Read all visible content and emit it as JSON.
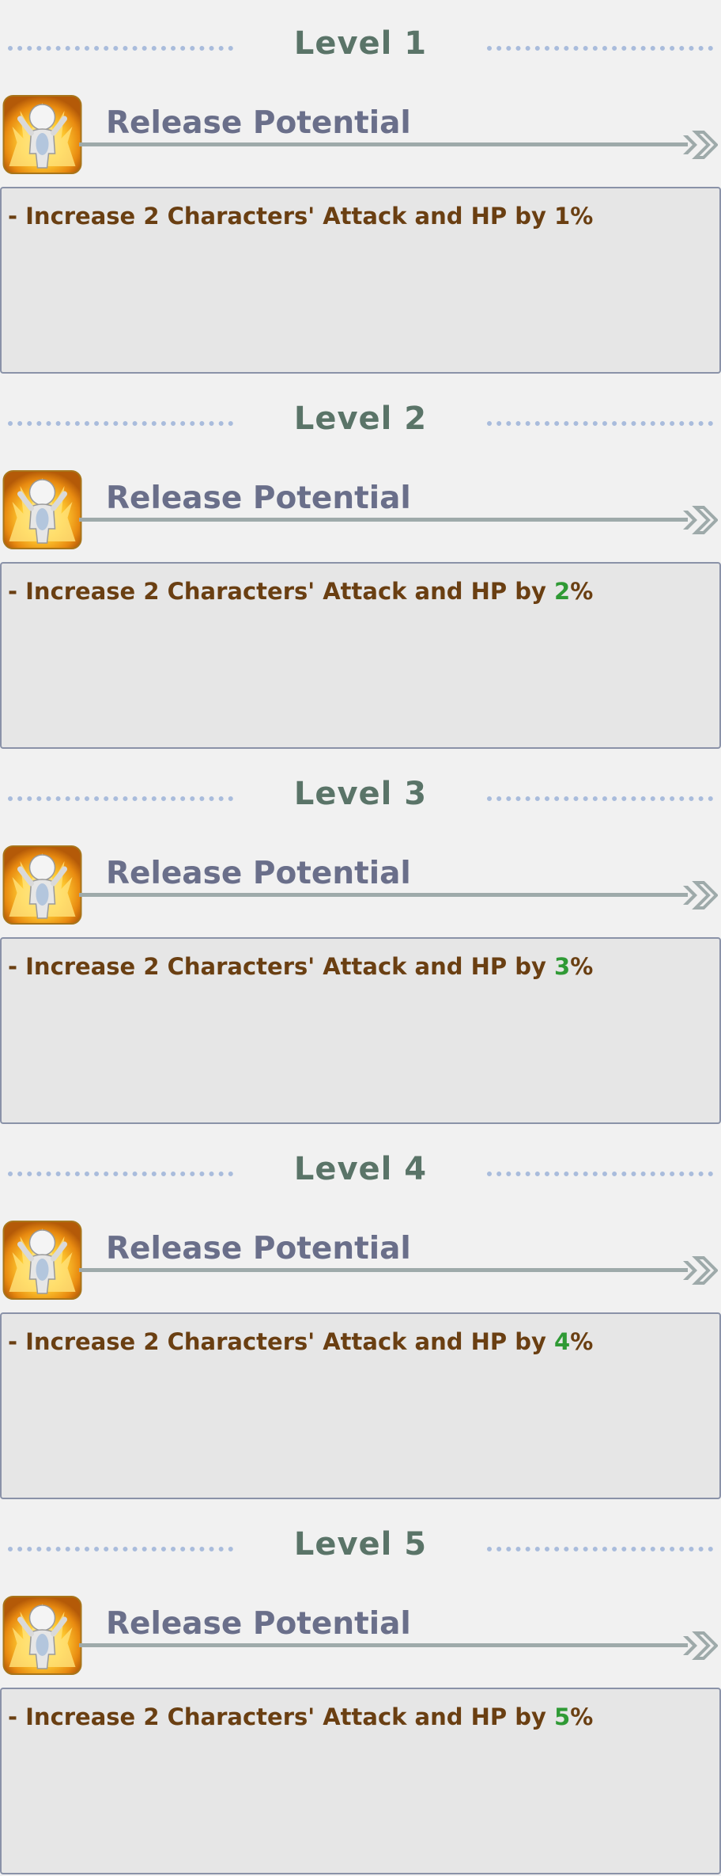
{
  "levels": [
    {
      "title": "Level 1",
      "skill_name": "Release Potential",
      "description_prefix": "- Increase 2 Characters' Attack and HP by ",
      "value": "1",
      "value_highlighted": false,
      "suffix": "%"
    },
    {
      "title": "Level 2",
      "skill_name": "Release Potential",
      "description_prefix": "- Increase 2 Characters' Attack and HP by ",
      "value": "2",
      "value_highlighted": true,
      "suffix": "%"
    },
    {
      "title": "Level 3",
      "skill_name": "Release Potential",
      "description_prefix": "- Increase 2 Characters' Attack and HP by ",
      "value": "3",
      "value_highlighted": true,
      "suffix": "%"
    },
    {
      "title": "Level 4",
      "skill_name": "Release Potential",
      "description_prefix": "- Increase 2 Characters' Attack and HP by ",
      "value": "4",
      "value_highlighted": true,
      "suffix": "%"
    },
    {
      "title": "Level 5",
      "skill_name": "Release Potential",
      "description_prefix": "- Increase 2 Characters' Attack and HP by ",
      "value": "5",
      "value_highlighted": true,
      "suffix": "%"
    }
  ],
  "icons": {
    "skill": "release-potential-icon",
    "arrow": "double-chevron-right-icon"
  },
  "colors": {
    "background": "#f1f1f1",
    "level_title": "#5a7468",
    "skill_name": "#6a6f8a",
    "description_text": "#6a3f12",
    "highlight_value": "#2f9a35",
    "box_background": "#e6e6e6",
    "box_border": "#8a92a8",
    "dots": "#a9bcdc"
  }
}
